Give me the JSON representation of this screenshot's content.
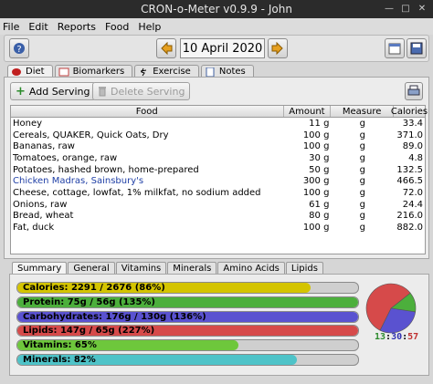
{
  "window": {
    "title": "CRON-o-Meter v0.9.9 - John"
  },
  "menu": [
    "File",
    "Edit",
    "Reports",
    "Food",
    "Help"
  ],
  "toolbar": {
    "date": "10 April 2020"
  },
  "tabs": [
    "Diet",
    "Biomarkers",
    "Exercise",
    "Notes"
  ],
  "actions": {
    "add": "Add Serving",
    "delete": "Delete Serving"
  },
  "table": {
    "headers": [
      "Food",
      "Amount",
      "Measure",
      "Calories"
    ],
    "rows": [
      [
        "Honey",
        "11 g",
        "g",
        "33.4"
      ],
      [
        "Cereals, QUAKER, Quick Oats, Dry",
        "100 g",
        "g",
        "371.0"
      ],
      [
        "Bananas, raw",
        "100 g",
        "g",
        "89.0"
      ],
      [
        "Tomatoes, orange, raw",
        "30 g",
        "g",
        "4.8"
      ],
      [
        "Potatoes, hashed brown, home-prepared",
        "50 g",
        "g",
        "132.5"
      ],
      [
        "Chicken Madras, Sainsbury's",
        "300 g",
        "g",
        "466.5"
      ],
      [
        "Cheese, cottage, lowfat, 1% milkfat, no sodium added",
        "100 g",
        "g",
        "72.0"
      ],
      [
        "Onions, raw",
        "61 g",
        "g",
        "24.4"
      ],
      [
        "Bread, wheat",
        "80 g",
        "g",
        "216.0"
      ],
      [
        "Fat, duck",
        "100 g",
        "g",
        "882.0"
      ]
    ]
  },
  "summary_tabs": [
    "Summary",
    "General",
    "Vitamins",
    "Minerals",
    "Amino Acids",
    "Lipids"
  ],
  "bars": [
    {
      "label": "Calories: 2291 / 2676 (86%)",
      "percent": 86,
      "color": "#d4c400"
    },
    {
      "label": "Protein: 75g / 56g (135%)",
      "percent": 100,
      "color": "#4caf3c"
    },
    {
      "label": "Carbohydrates: 176g / 130g (136%)",
      "percent": 100,
      "color": "#5a52d0"
    },
    {
      "label": "Lipids: 147g / 65g (227%)",
      "percent": 100,
      "color": "#d64a4a"
    },
    {
      "label": "Vitamins: 65%",
      "percent": 65,
      "color": "#6ec73c"
    },
    {
      "label": "Minerals: 82%",
      "percent": 82,
      "color": "#4ec3c8"
    }
  ],
  "pie": {
    "slices": [
      {
        "name": "Protein",
        "value": 13,
        "color": "#4caf3c"
      },
      {
        "name": "Carbohydrates",
        "value": 30,
        "color": "#5a52d0"
      },
      {
        "name": "Lipids",
        "value": 57,
        "color": "#d64a4a"
      }
    ]
  },
  "ratio": [
    "13",
    ":",
    "30",
    ":",
    "57"
  ],
  "ratio_colors": [
    "#2e8b2e",
    "#000000",
    "#2f2fb0",
    "#000000",
    "#c03030"
  ],
  "icons": {
    "help": "question-icon",
    "prev": "left-arrow-icon",
    "next": "right-arrow-icon",
    "calendar": "calendar-icon",
    "save": "save-icon",
    "print": "print-icon",
    "add": "plus-icon",
    "delete": "trash-icon"
  }
}
